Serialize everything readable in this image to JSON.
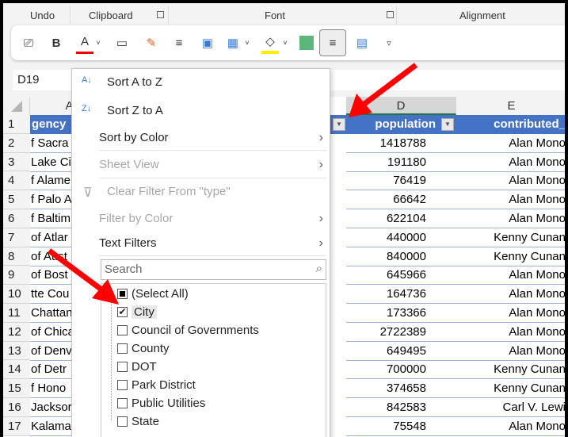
{
  "ribbon": {
    "groups": [
      "Undo",
      "Clipboard",
      "Font",
      "Alignment"
    ]
  },
  "toolbar": {
    "bold": "B",
    "font_color": "A"
  },
  "name_box": "D19",
  "columns": [
    "A",
    "D",
    "E"
  ],
  "header_row": {
    "a": "gency",
    "d": "population",
    "e": "contributed_"
  },
  "rows": [
    {
      "n": "2",
      "a": "f Sacra",
      "d": "1418788",
      "e": "Alan Mono"
    },
    {
      "n": "3",
      "a": "Lake Ci",
      "d": "191180",
      "e": "Alan Mono"
    },
    {
      "n": "4",
      "a": "f Alame",
      "d": "76419",
      "e": "Alan Mono"
    },
    {
      "n": "5",
      "a": "f Palo A",
      "d": "66642",
      "e": "Alan Mono"
    },
    {
      "n": "6",
      "a": "f Baltim",
      "d": "622104",
      "e": "Alan Mono"
    },
    {
      "n": "7",
      "a": "of Atlar",
      "d": "440000",
      "e": "Kenny Cunan"
    },
    {
      "n": "8",
      "a": "of Aust",
      "d": "840000",
      "e": "Kenny Cunan"
    },
    {
      "n": "9",
      "a": "of Bost",
      "d": "645966",
      "e": "Alan Mono"
    },
    {
      "n": "10",
      "a": "tte Cou",
      "d": "164736",
      "e": "Alan Mono"
    },
    {
      "n": "11",
      "a": "Chattan",
      "d": "173366",
      "e": "Alan Mono"
    },
    {
      "n": "12",
      "a": "of Chica",
      "d": "2722389",
      "e": "Alan Mono"
    },
    {
      "n": "13",
      "a": "of Denv",
      "d": "649495",
      "e": "Alan Mono"
    },
    {
      "n": "14",
      "a": "of Detr",
      "d": "700000",
      "e": "Kenny Cunan"
    },
    {
      "n": "15",
      "a": "f Hono",
      "d": "374658",
      "e": "Kenny Cunan"
    },
    {
      "n": "16",
      "a": "Jacksor",
      "d": "842583",
      "e": "Carl V. Lewi"
    },
    {
      "n": "17",
      "a": "Kalama",
      "d": "75548",
      "e": "Alan Mono"
    }
  ],
  "row1_number": "1",
  "filter_menu": {
    "sort_az": "Sort A to Z",
    "sort_za": "Sort Z to A",
    "sort_by_color": "Sort by Color",
    "sheet_view": "Sheet View",
    "clear_filter": "Clear Filter From \"type\"",
    "filter_by_color": "Filter by Color",
    "text_filters": "Text Filters",
    "search_placeholder": "Search",
    "items": [
      {
        "label": "(Select All)",
        "state": "partial"
      },
      {
        "label": "City",
        "state": "checked"
      },
      {
        "label": "Council of Governments",
        "state": "unchecked"
      },
      {
        "label": "County",
        "state": "unchecked"
      },
      {
        "label": "DOT",
        "state": "unchecked"
      },
      {
        "label": "Park District",
        "state": "unchecked"
      },
      {
        "label": "Public Utilities",
        "state": "unchecked"
      },
      {
        "label": "State",
        "state": "unchecked"
      }
    ]
  },
  "colors": {
    "header": "#4472c4",
    "arrow": "#ff0000"
  }
}
